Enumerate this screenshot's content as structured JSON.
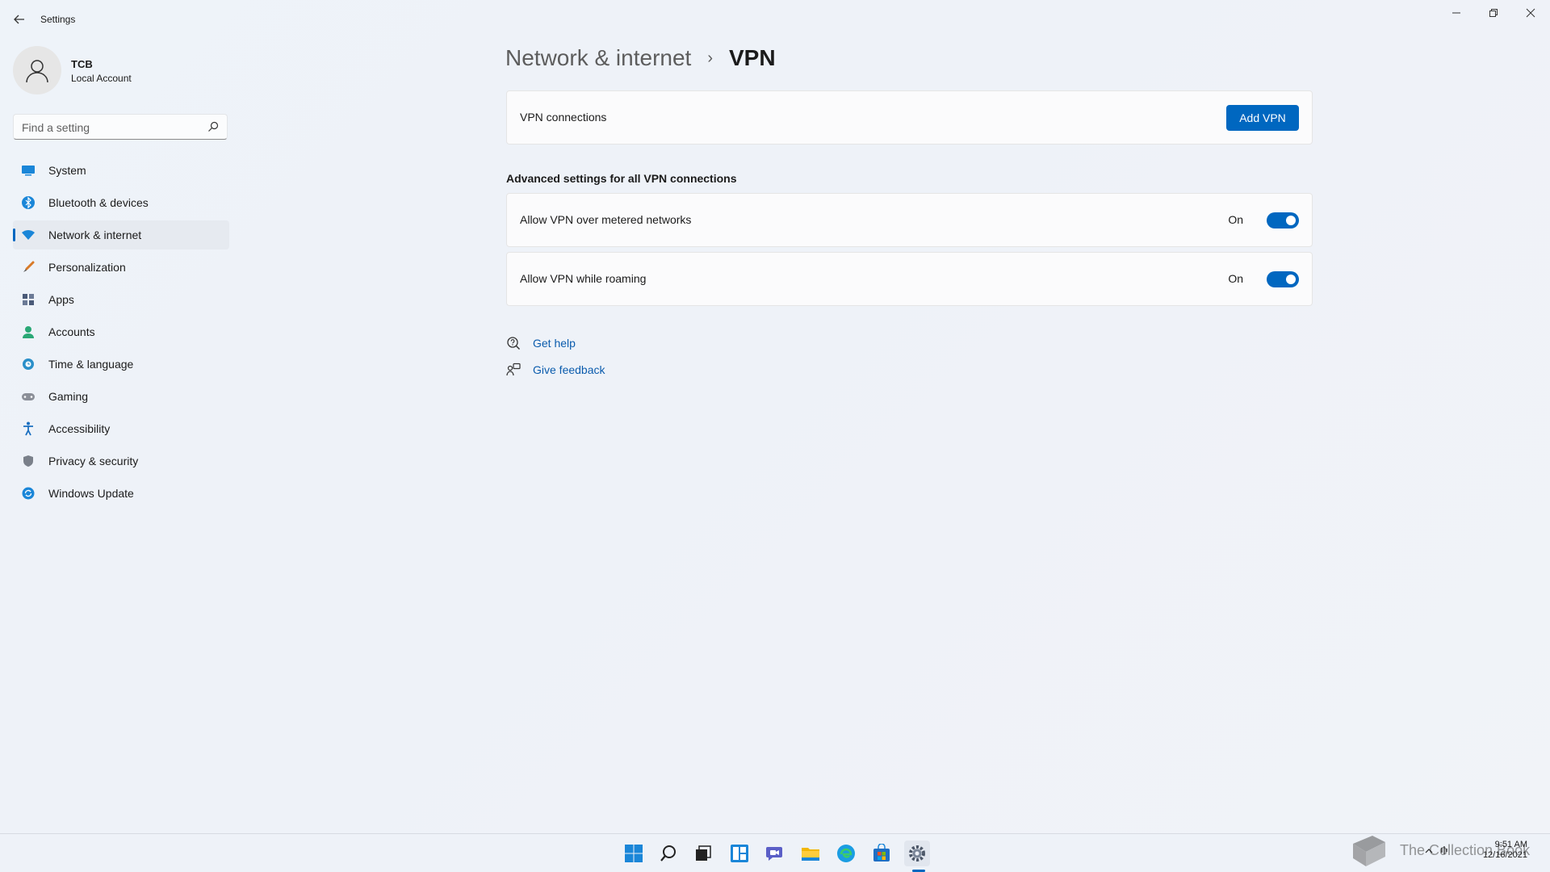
{
  "window": {
    "title": "Settings"
  },
  "profile": {
    "name": "TCB",
    "account_type": "Local Account"
  },
  "search": {
    "placeholder": "Find a setting",
    "value": ""
  },
  "sidebar": {
    "items": [
      {
        "label": "System",
        "icon": "system-icon",
        "active": false
      },
      {
        "label": "Bluetooth & devices",
        "icon": "bluetooth-icon",
        "active": false
      },
      {
        "label": "Network & internet",
        "icon": "wifi-icon",
        "active": true
      },
      {
        "label": "Personalization",
        "icon": "brush-icon",
        "active": false
      },
      {
        "label": "Apps",
        "icon": "apps-icon",
        "active": false
      },
      {
        "label": "Accounts",
        "icon": "person-icon",
        "active": false
      },
      {
        "label": "Time & language",
        "icon": "globe-clock-icon",
        "active": false
      },
      {
        "label": "Gaming",
        "icon": "gamepad-icon",
        "active": false
      },
      {
        "label": "Accessibility",
        "icon": "accessibility-icon",
        "active": false
      },
      {
        "label": "Privacy & security",
        "icon": "shield-icon",
        "active": false
      },
      {
        "label": "Windows Update",
        "icon": "update-icon",
        "active": false
      }
    ]
  },
  "breadcrumb": {
    "parent": "Network & internet",
    "separator": "›",
    "current": "VPN"
  },
  "vpn_connections": {
    "label": "VPN connections",
    "button_label": "Add VPN"
  },
  "advanced": {
    "heading": "Advanced settings for all VPN connections",
    "settings": [
      {
        "label": "Allow VPN over metered networks",
        "state_label": "On",
        "enabled": true
      },
      {
        "label": "Allow VPN while roaming",
        "state_label": "On",
        "enabled": true
      }
    ]
  },
  "help_links": {
    "get_help": "Get help",
    "give_feedback": "Give feedback"
  },
  "taskbar": {
    "icons": [
      "start-icon",
      "search-icon",
      "task-view-icon",
      "widgets-icon",
      "chat-icon",
      "file-explorer-icon",
      "edge-icon",
      "store-icon",
      "settings-icon"
    ],
    "watermark": "The Collection Book",
    "clock_time": "9:51 AM",
    "clock_date": "12/16/2021"
  },
  "colors": {
    "accent": "#0067c0",
    "link": "#0b5cad",
    "background": "#eef3f9"
  }
}
